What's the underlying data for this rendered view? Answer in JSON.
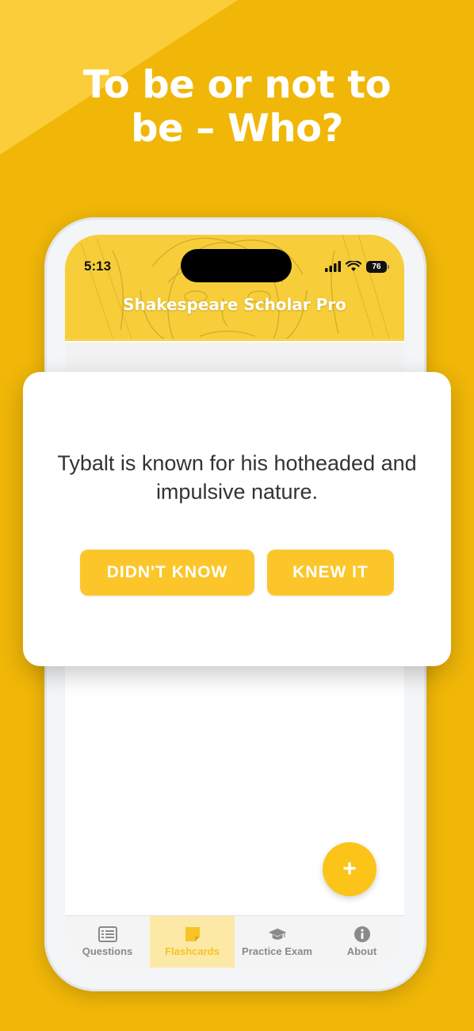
{
  "headline": {
    "line1": "To be or not to",
    "line2": "be – Who?"
  },
  "status_bar": {
    "time": "5:13",
    "battery": "76"
  },
  "app": {
    "title": "Shakespeare Scholar Pro"
  },
  "flashcard": {
    "text": "Tybalt is known for his hotheaded and impulsive nature.",
    "didnt_know_label": "DIDN'T KNOW",
    "knew_it_label": "KNEW IT"
  },
  "fab": {
    "label": "+"
  },
  "tabs": [
    {
      "label": "Questions",
      "icon": "list-icon",
      "active": false
    },
    {
      "label": "Flashcards",
      "icon": "flashcard-icon",
      "active": true
    },
    {
      "label": "Practice Exam",
      "icon": "graduation-cap-icon",
      "active": false
    },
    {
      "label": "About",
      "icon": "info-icon",
      "active": false
    }
  ],
  "colors": {
    "background": "#f0b708",
    "accent": "#fcc62a",
    "active_tab_bg": "#fde9a6",
    "card": "#ffffff"
  }
}
